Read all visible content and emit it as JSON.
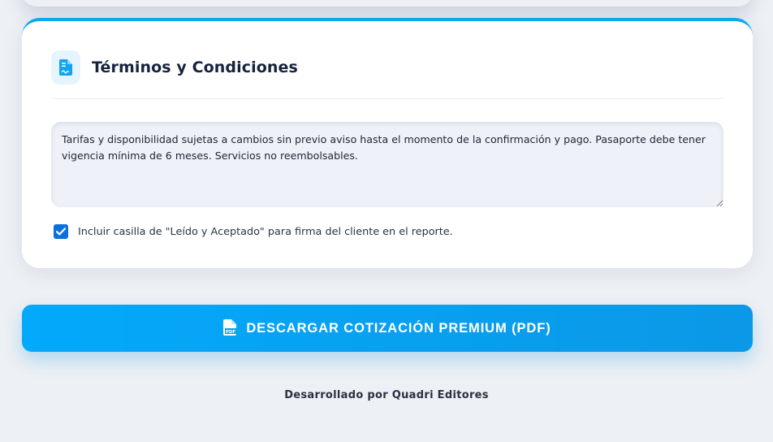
{
  "terms_card": {
    "title": "Términos y Condiciones",
    "icon": "file-contract-icon",
    "terms_text": "Tarifas y disponibilidad sujetas a cambios sin previo aviso hasta el momento de la confirmación y pago. Pasaporte debe tener vigencia mínima de 6 meses. Servicios no reembolsables.",
    "accept_checkbox": {
      "checked": true,
      "label": "Incluir casilla de \"Leído y Aceptado\" para firma del cliente en el reporte."
    }
  },
  "download_button": {
    "label": "DESCARGAR COTIZACIÓN PREMIUM (PDF)",
    "icon": "file-pdf-icon"
  },
  "footer": {
    "credit": "Desarrollado por Quadri Editores"
  },
  "colors": {
    "accent": "#0aa8f0",
    "button": "#04a9fb",
    "checkbox": "#0b6fdc",
    "title": "#16233d"
  }
}
